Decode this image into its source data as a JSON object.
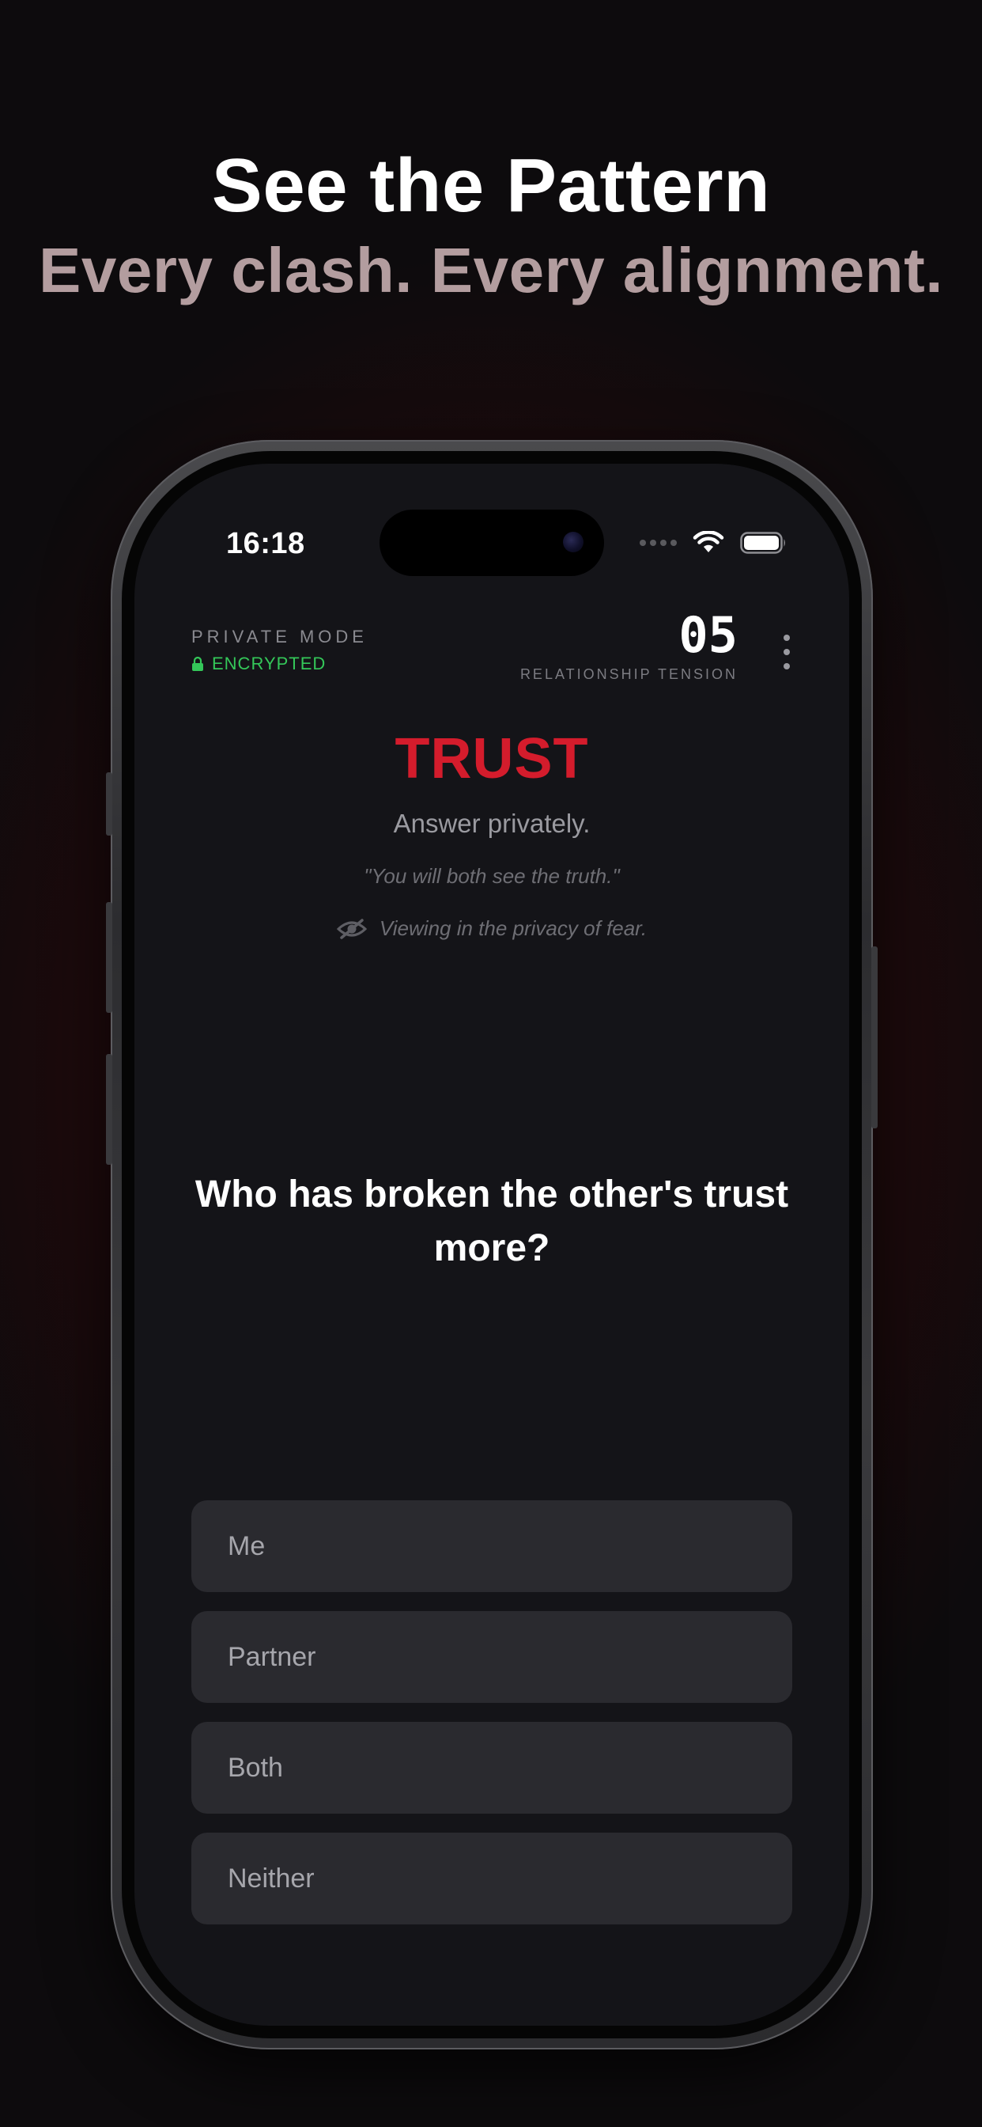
{
  "promo": {
    "headline": "See the Pattern",
    "subheadline": "Every clash. Every alignment."
  },
  "status_bar": {
    "time": "16:18"
  },
  "header": {
    "mode_label": "PRIVATE MODE",
    "encryption_label": "ENCRYPTED",
    "tension_value": "05",
    "tension_label": "RELATIONSHIP TENSION"
  },
  "card": {
    "category": "TRUST",
    "instruction": "Answer privately.",
    "quote": "\"You will both see the truth.\"",
    "privacy_note": "Viewing in the privacy of fear.",
    "question": "Who has broken the other's trust more?"
  },
  "options": [
    {
      "label": "Me"
    },
    {
      "label": "Partner"
    },
    {
      "label": "Both"
    },
    {
      "label": "Neither"
    }
  ],
  "colors": {
    "accent_red": "#d41c2c",
    "encrypted_green": "#34c759",
    "screen_bg": "#141418",
    "option_bg": "#2a2a2f"
  },
  "icons": {
    "lock": "lock-icon",
    "privacy": "eye-slash-icon",
    "menu": "more-vertical-icon",
    "wifi": "wifi-icon",
    "battery": "battery-icon",
    "signal": "cellular-signal-icon"
  }
}
